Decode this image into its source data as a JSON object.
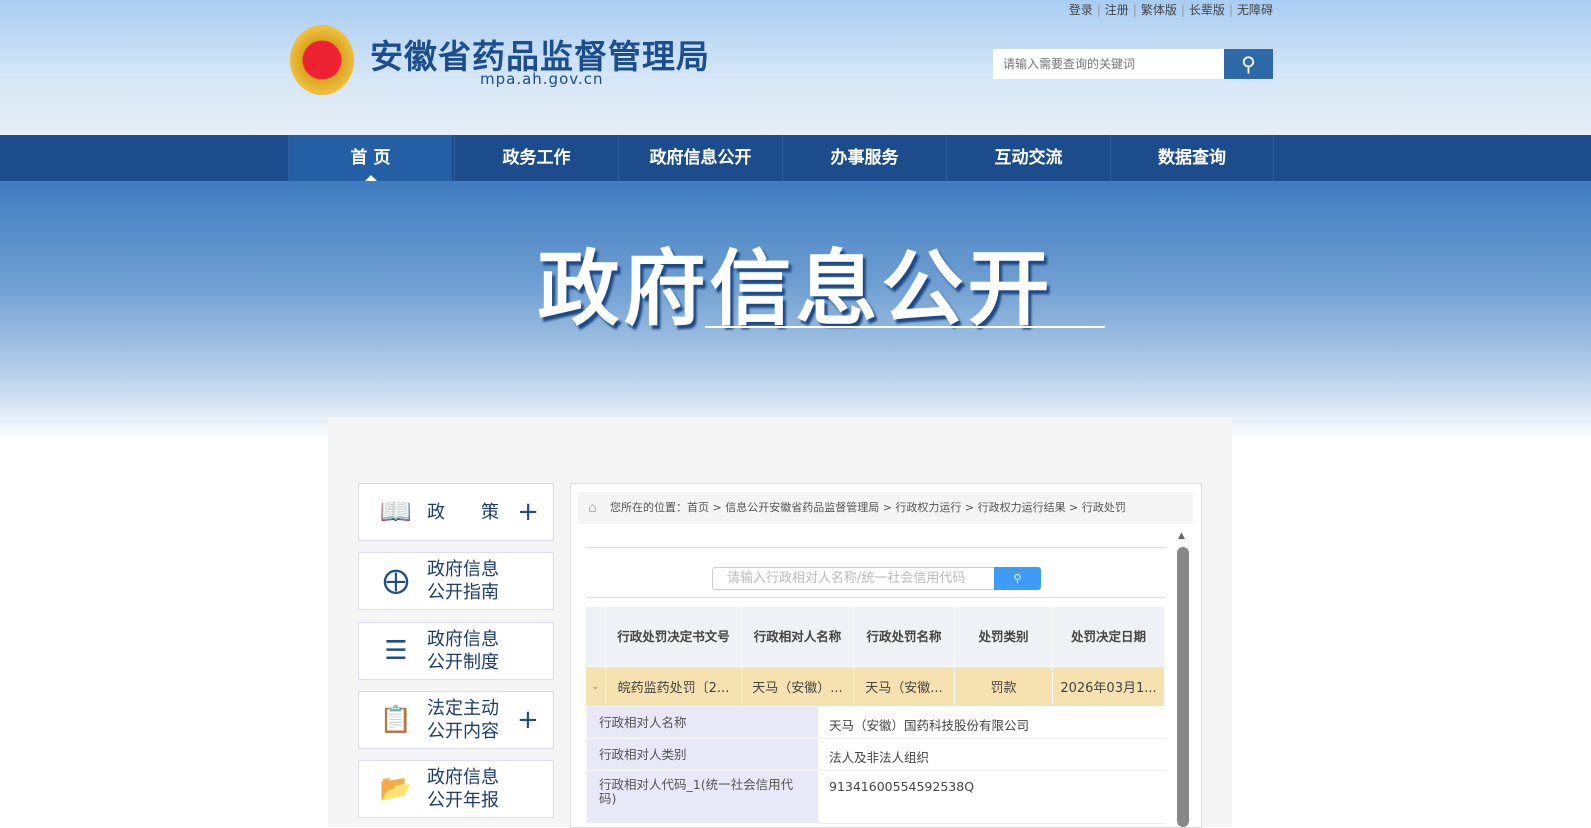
{
  "header": {
    "top_links": [
      "登录",
      "注册",
      "繁体版",
      "长辈版",
      "无障碍"
    ],
    "site_name": "安徽省药品监督管理局",
    "site_url": "mpa.ah.gov.cn",
    "search_placeholder": "请输入需要查询的关键词"
  },
  "nav": [
    "首 页",
    "政务工作",
    "政府信息公开",
    "办事服务",
    "互动交流",
    "数据查询"
  ],
  "banner_title": "政府信息公开",
  "sidebar": [
    {
      "label": "政　　策",
      "icon": "book-icon",
      "plus": "+"
    },
    {
      "label": "政府信息公开指南",
      "icon": "compass-icon"
    },
    {
      "label": "政府信息公开制度",
      "icon": "list-icon"
    },
    {
      "label": "法定主动公开内容",
      "icon": "clipboard-icon",
      "plus": "+"
    },
    {
      "label": "政府信息公开年报",
      "icon": "folder-icon"
    }
  ],
  "breadcrumb": {
    "prefix": "您所在的位置：",
    "items": [
      "首页",
      "信息公开安徽省药品监督管理局",
      "行政权力运行",
      "行政权力运行结果",
      "行政处罚"
    ]
  },
  "query": {
    "placeholder": "请输入行政相对人名称/统一社会信用代码"
  },
  "table": {
    "headers": [
      "行政处罚决定书文号",
      "行政相对人名称",
      "行政处罚名称",
      "处罚类别",
      "处罚决定日期"
    ],
    "row": [
      "皖药监药处罚〔2...",
      "天马（安徽）...",
      "天马（安徽...",
      "罚款",
      "2026年03月1..."
    ],
    "details": [
      {
        "label": "行政相对人名称",
        "value": "天马（安徽）国药科技股份有限公司"
      },
      {
        "label": "行政相对人类别",
        "value": "法人及非法人组织"
      },
      {
        "label": "行政相对人代码_1(统一社会信用代码)",
        "value": "91341600554592538Q"
      }
    ]
  }
}
